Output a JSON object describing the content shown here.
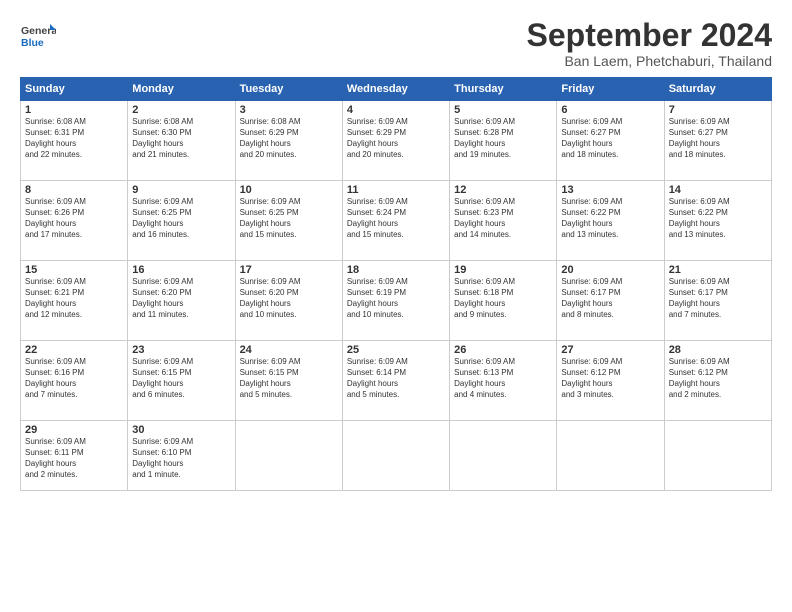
{
  "logo": {
    "general": "General",
    "blue": "Blue"
  },
  "title": "September 2024",
  "location": "Ban Laem, Phetchaburi, Thailand",
  "days_header": [
    "Sunday",
    "Monday",
    "Tuesday",
    "Wednesday",
    "Thursday",
    "Friday",
    "Saturday"
  ],
  "weeks": [
    [
      {
        "day": 1,
        "sunrise": "6:08 AM",
        "sunset": "6:31 PM",
        "daylight": "12 hours and 22 minutes."
      },
      {
        "day": 2,
        "sunrise": "6:08 AM",
        "sunset": "6:30 PM",
        "daylight": "12 hours and 21 minutes."
      },
      {
        "day": 3,
        "sunrise": "6:08 AM",
        "sunset": "6:29 PM",
        "daylight": "12 hours and 20 minutes."
      },
      {
        "day": 4,
        "sunrise": "6:09 AM",
        "sunset": "6:29 PM",
        "daylight": "12 hours and 20 minutes."
      },
      {
        "day": 5,
        "sunrise": "6:09 AM",
        "sunset": "6:28 PM",
        "daylight": "12 hours and 19 minutes."
      },
      {
        "day": 6,
        "sunrise": "6:09 AM",
        "sunset": "6:27 PM",
        "daylight": "12 hours and 18 minutes."
      },
      {
        "day": 7,
        "sunrise": "6:09 AM",
        "sunset": "6:27 PM",
        "daylight": "12 hours and 18 minutes."
      }
    ],
    [
      {
        "day": 8,
        "sunrise": "6:09 AM",
        "sunset": "6:26 PM",
        "daylight": "12 hours and 17 minutes."
      },
      {
        "day": 9,
        "sunrise": "6:09 AM",
        "sunset": "6:25 PM",
        "daylight": "12 hours and 16 minutes."
      },
      {
        "day": 10,
        "sunrise": "6:09 AM",
        "sunset": "6:25 PM",
        "daylight": "12 hours and 15 minutes."
      },
      {
        "day": 11,
        "sunrise": "6:09 AM",
        "sunset": "6:24 PM",
        "daylight": "12 hours and 15 minutes."
      },
      {
        "day": 12,
        "sunrise": "6:09 AM",
        "sunset": "6:23 PM",
        "daylight": "12 hours and 14 minutes."
      },
      {
        "day": 13,
        "sunrise": "6:09 AM",
        "sunset": "6:22 PM",
        "daylight": "12 hours and 13 minutes."
      },
      {
        "day": 14,
        "sunrise": "6:09 AM",
        "sunset": "6:22 PM",
        "daylight": "12 hours and 13 minutes."
      }
    ],
    [
      {
        "day": 15,
        "sunrise": "6:09 AM",
        "sunset": "6:21 PM",
        "daylight": "12 hours and 12 minutes."
      },
      {
        "day": 16,
        "sunrise": "6:09 AM",
        "sunset": "6:20 PM",
        "daylight": "12 hours and 11 minutes."
      },
      {
        "day": 17,
        "sunrise": "6:09 AM",
        "sunset": "6:20 PM",
        "daylight": "12 hours and 10 minutes."
      },
      {
        "day": 18,
        "sunrise": "6:09 AM",
        "sunset": "6:19 PM",
        "daylight": "12 hours and 10 minutes."
      },
      {
        "day": 19,
        "sunrise": "6:09 AM",
        "sunset": "6:18 PM",
        "daylight": "12 hours and 9 minutes."
      },
      {
        "day": 20,
        "sunrise": "6:09 AM",
        "sunset": "6:17 PM",
        "daylight": "12 hours and 8 minutes."
      },
      {
        "day": 21,
        "sunrise": "6:09 AM",
        "sunset": "6:17 PM",
        "daylight": "12 hours and 7 minutes."
      }
    ],
    [
      {
        "day": 22,
        "sunrise": "6:09 AM",
        "sunset": "6:16 PM",
        "daylight": "12 hours and 7 minutes."
      },
      {
        "day": 23,
        "sunrise": "6:09 AM",
        "sunset": "6:15 PM",
        "daylight": "12 hours and 6 minutes."
      },
      {
        "day": 24,
        "sunrise": "6:09 AM",
        "sunset": "6:15 PM",
        "daylight": "12 hours and 5 minutes."
      },
      {
        "day": 25,
        "sunrise": "6:09 AM",
        "sunset": "6:14 PM",
        "daylight": "12 hours and 5 minutes."
      },
      {
        "day": 26,
        "sunrise": "6:09 AM",
        "sunset": "6:13 PM",
        "daylight": "12 hours and 4 minutes."
      },
      {
        "day": 27,
        "sunrise": "6:09 AM",
        "sunset": "6:12 PM",
        "daylight": "12 hours and 3 minutes."
      },
      {
        "day": 28,
        "sunrise": "6:09 AM",
        "sunset": "6:12 PM",
        "daylight": "12 hours and 2 minutes."
      }
    ],
    [
      {
        "day": 29,
        "sunrise": "6:09 AM",
        "sunset": "6:11 PM",
        "daylight": "12 hours and 2 minutes."
      },
      {
        "day": 30,
        "sunrise": "6:09 AM",
        "sunset": "6:10 PM",
        "daylight": "12 hours and 1 minute."
      },
      null,
      null,
      null,
      null,
      null
    ]
  ]
}
